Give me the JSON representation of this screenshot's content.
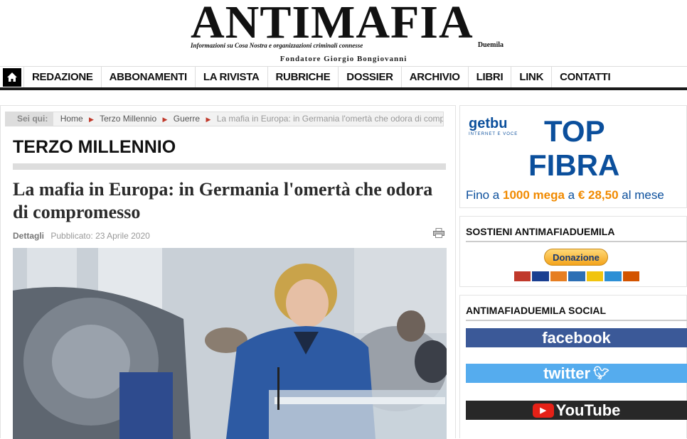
{
  "site": {
    "logo_word": "ANTIMAFIA",
    "logo_tagline": "Informazioni su Cosa Nostra e organizzazioni criminali connesse",
    "logo_suffix": "Duemila",
    "founder": "Fondatore Giorgio Bongiovanni"
  },
  "nav": {
    "items": [
      "REDAZIONE",
      "ABBONAMENTI",
      "LA RIVISTA",
      "RUBRICHE",
      "DOSSIER",
      "ARCHIVIO",
      "LIBRI",
      "LINK",
      "CONTATTI"
    ]
  },
  "breadcrumb": {
    "label": "Sei qui:",
    "items": [
      "Home",
      "Terzo Millennio",
      "Guerre"
    ],
    "current": "La mafia in Europa: in Germania l'omertà che odora di compromesso"
  },
  "article": {
    "section": "TERZO MILLENNIO",
    "title": "La mafia in Europa: in Germania l'omertà che odora di compromesso",
    "details_label": "Dettagli",
    "published": "Pubblicato: 23 Aprile 2020"
  },
  "sidebar": {
    "ad": {
      "brand": "getbu",
      "brand_sub": "INTERNET E VOCE",
      "headline1": "TOP",
      "headline2": "FIBRA",
      "offer_prefix": "Fino a ",
      "offer_speed": "1000 mega",
      "offer_mid": " a ",
      "offer_price": "€ 28,50",
      "offer_suffix": " al mese"
    },
    "support_title": "SOSTIENI ANTIMAFIADUEMILA",
    "donate_label": "Donazione",
    "social_title": "ANTIMAFIADUEMILA SOCIAL",
    "social": {
      "facebook": "facebook",
      "twitter": "twitter",
      "youtube": "YouTube"
    },
    "colors": {
      "facebook": "#3b5998",
      "twitter": "#55acee",
      "youtube": "#282828",
      "ad_blue": "#0b4f9c",
      "ad_orange": "#f18a00"
    }
  }
}
